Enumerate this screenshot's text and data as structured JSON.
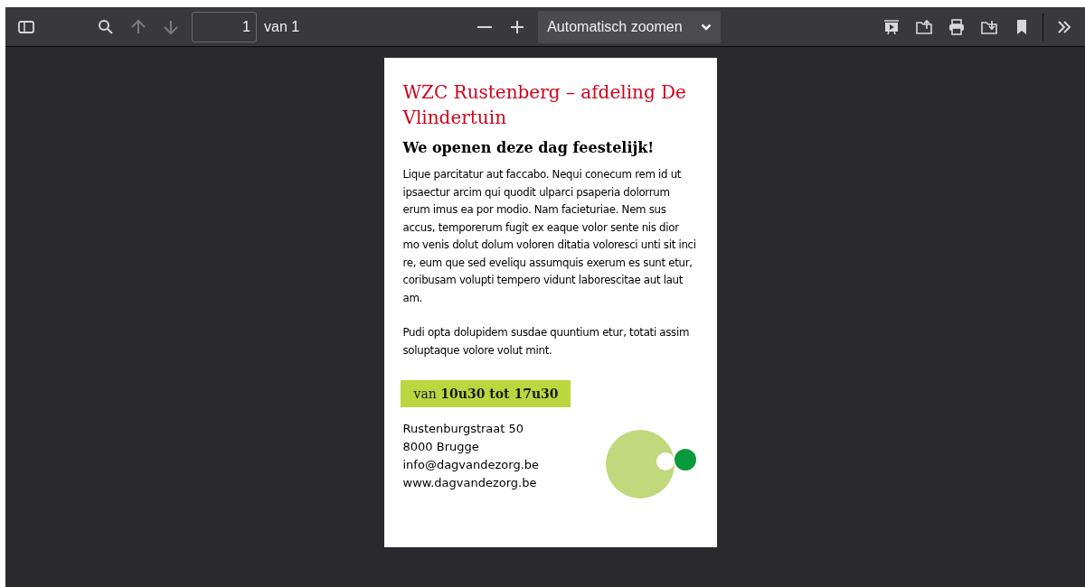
{
  "toolbar": {
    "page_number": "1",
    "page_count": "van 1",
    "zoom": "Automatisch zoomen",
    "nav": [
      {
        "kind": "up",
        "disabled": true
      },
      {
        "kind": "down",
        "disabled": true
      }
    ]
  },
  "document": {
    "title": "WZC Rustenberg – afdeling De Vlindertuin",
    "subtitle": "We openen deze dag feestelijk!",
    "paragraphs": [
      "Lique parcitatur aut faccabo. Nequi conecum rem id ut ipsaectur arcim qui quodit ulparci psaperia dolorrum erum imus ea por modio. Nam facieturiae. Nem sus accus, temporerum fugit ex eaque volor sente nis dior mo venis dolut dolum voloren ditatia voloresci unti sit inci re, eum que sed eveliqu assumquis exerum es sunt etur, coribusam volupti tempero vidunt laborescitae aut laut am.",
      "Pudi opta dolupidem susdae quuntium etur, totati assim soluptaque volore volut mint."
    ],
    "time": "van **10u30 tot 17u30**",
    "address": [
      "Rustenburgstraat 50",
      "8000 Brugge",
      "info@dagvandezorg.be",
      "www.dagvandezorg.be"
    ]
  }
}
